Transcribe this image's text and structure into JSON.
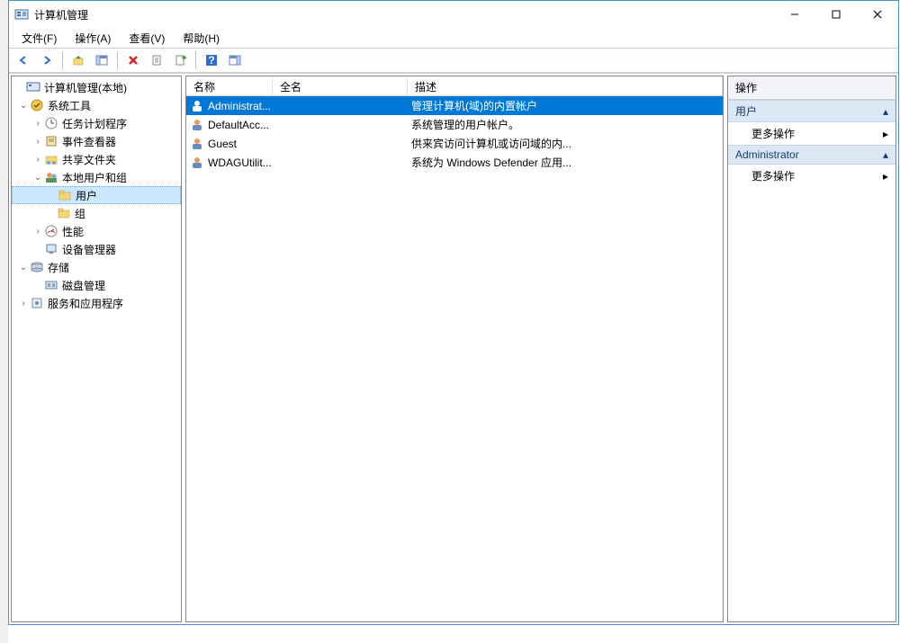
{
  "window": {
    "title": "计算机管理"
  },
  "menu": {
    "file": "文件(F)",
    "action": "操作(A)",
    "view": "查看(V)",
    "help": "帮助(H)"
  },
  "tree": {
    "root": "计算机管理(本地)",
    "system_tools": "系统工具",
    "task_scheduler": "任务计划程序",
    "event_viewer": "事件查看器",
    "shared_folders": "共享文件夹",
    "local_users": "本地用户和组",
    "users": "用户",
    "groups": "组",
    "performance": "性能",
    "device_manager": "设备管理器",
    "storage": "存储",
    "disk_mgmt": "磁盘管理",
    "services_apps": "服务和应用程序"
  },
  "list": {
    "headers": {
      "name": "名称",
      "fullname": "全名",
      "desc": "描述"
    },
    "rows": [
      {
        "name": "Administrat...",
        "fullname": "",
        "desc": "管理计算机(域)的内置帐户"
      },
      {
        "name": "DefaultAcc...",
        "fullname": "",
        "desc": "系统管理的用户帐户。"
      },
      {
        "name": "Guest",
        "fullname": "",
        "desc": "供来宾访问计算机或访问域的内..."
      },
      {
        "name": "WDAGUtilit...",
        "fullname": "",
        "desc": "系统为 Windows Defender 应用..."
      }
    ]
  },
  "actions": {
    "header": "操作",
    "group1": "用户",
    "more": "更多操作",
    "group2": "Administrator"
  }
}
